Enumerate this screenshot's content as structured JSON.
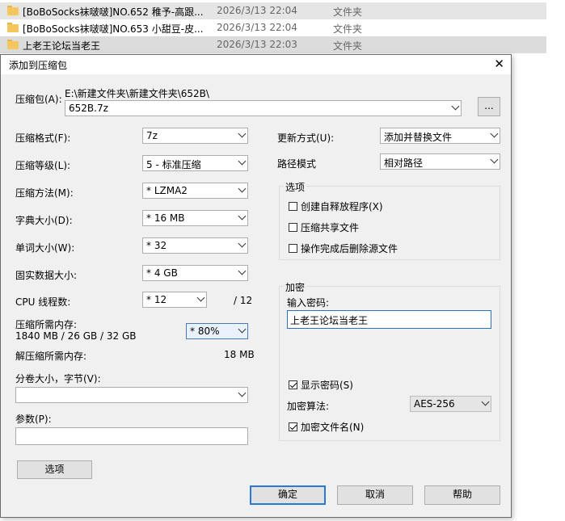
{
  "files": [
    {
      "name": "[BoBoSocks袜啵啵]NO.652 稚予-高跟...",
      "date": "2026/3/13 22:04",
      "type": "文件夹"
    },
    {
      "name": "[BoBoSocks袜啵啵]NO.653 小甜豆-皮...",
      "date": "2026/3/13 22:04",
      "type": "文件夹"
    },
    {
      "name": "上老王论坛当老王",
      "date": "2026/3/13 22:03",
      "type": "文件夹"
    }
  ],
  "dialog": {
    "title": "添加到压缩包",
    "close": "✕",
    "archive_label": "压缩包(A):",
    "archive_path": "E:\\新建文件夹\\新建文件夹\\652B\\",
    "archive_name": "652B.7z",
    "browse_label": "...",
    "format_label": "压缩格式(F):",
    "format_value": "7z",
    "level_label": "压缩等级(L):",
    "level_value": "5 - 标准压缩",
    "method_label": "压缩方法(M):",
    "method_value": "* LZMA2",
    "dict_label": "字典大小(D):",
    "dict_value": "* 16 MB",
    "word_label": "单词大小(W):",
    "word_value": "* 32",
    "solid_label": "固实数据大小:",
    "solid_value": "* 4 GB",
    "cpu_label": "CPU 线程数:",
    "cpu_value": "* 12",
    "cpu_total": "/ 12",
    "mem_label": "压缩所需内存:",
    "mem_detail": "1840 MB / 26 GB / 32 GB",
    "mem_value": "* 80%",
    "decomp_label": "解压缩所需内存:",
    "decomp_value": "18 MB",
    "split_label": "分卷大小，字节(V):",
    "split_value": "",
    "params_label": "参数(P):",
    "params_value": "",
    "options_button": "选项",
    "update_label": "更新方式(U):",
    "update_value": "添加并替换文件",
    "path_label": "路径模式",
    "path_value": "相对路径",
    "options_group": "选项",
    "opt_sfx": "创建自释放程序(X)",
    "opt_shared": "压缩共享文件",
    "opt_delete": "操作完成后删除源文件",
    "encrypt_group": "加密",
    "password_label": "输入密码:",
    "password_value": "上老王论坛当老王",
    "show_password": "显示密码(S)",
    "enc_method_label": "加密算法:",
    "enc_method_value": "AES-256",
    "encrypt_names": "加密文件名(N)",
    "ok": "确定",
    "cancel": "取消",
    "help": "帮助"
  }
}
